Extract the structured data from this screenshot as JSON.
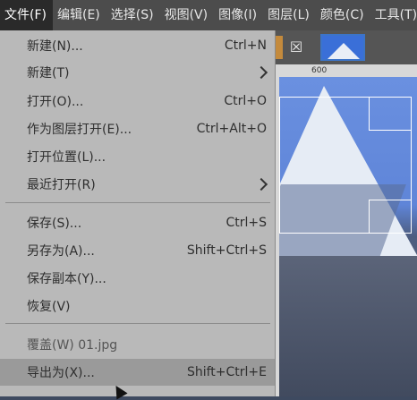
{
  "menubar": {
    "items": [
      "文件(F)",
      "编辑(E)",
      "选择(S)",
      "视图(V)",
      "图像(I)",
      "图层(L)",
      "颜色(C)",
      "工具(T)"
    ]
  },
  "workspace": {
    "tab_close_glyph": "☒",
    "ruler_tick": "600"
  },
  "file_menu": {
    "items": [
      {
        "label": "新建(N)...",
        "accel": "Ctrl+N"
      },
      {
        "label": "新建(T)",
        "accel": ""
      },
      {
        "label": "打开(O)...",
        "accel": "Ctrl+O"
      },
      {
        "label": "作为图层打开(E)...",
        "accel": "Ctrl+Alt+O"
      },
      {
        "label": "打开位置(L)...",
        "accel": ""
      },
      {
        "label": "最近打开(R)",
        "accel": ""
      },
      {
        "label": "保存(S)...",
        "accel": "Ctrl+S"
      },
      {
        "label": "另存为(A)...",
        "accel": "Shift+Ctrl+S"
      },
      {
        "label": "保存副本(Y)...",
        "accel": ""
      },
      {
        "label": "恢复(V)",
        "accel": ""
      },
      {
        "label": "覆盖(W) 01.jpg",
        "accel": ""
      },
      {
        "label": "导出为(X)...",
        "accel": "Shift+Ctrl+E"
      }
    ]
  },
  "colors": {
    "menubar_bg": "#4c4c4c",
    "menu_bg": "#b9b9b9",
    "highlight_bg": "#9a9a9a"
  }
}
